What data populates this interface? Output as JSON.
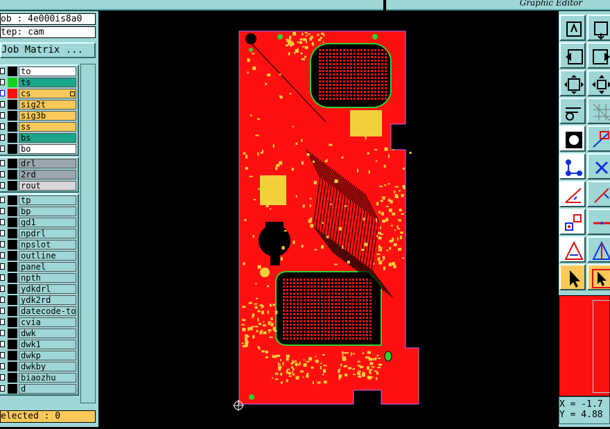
{
  "app": {
    "title": "Graphic Editor"
  },
  "job": {
    "label": "ob : 4e000is8a0",
    "step_label": "tep: cam"
  },
  "job_matrix_button": "Job Matrix ...",
  "board_layers": [
    {
      "name": "to",
      "swatch": "#000000",
      "bg": "#ffffff"
    },
    {
      "name": "ts",
      "swatch": "#18d020",
      "bg": "#1aa68a"
    },
    {
      "name": "cs",
      "swatch": "#ff1010",
      "bg": "#fbc95a"
    },
    {
      "name": "sig2t",
      "swatch": "#000000",
      "bg": "#fbc95a"
    },
    {
      "name": "sig3b",
      "swatch": "#000000",
      "bg": "#fbc95a"
    },
    {
      "name": "ss",
      "swatch": "#000000",
      "bg": "#fbc95a"
    },
    {
      "name": "bs",
      "swatch": "#000000",
      "bg": "#1aa68a"
    },
    {
      "name": "bo",
      "swatch": "#000000",
      "bg": "#ffffff"
    }
  ],
  "drill_layers": [
    {
      "name": "drl",
      "swatch": "#000000",
      "bg": "#9aa6b0"
    },
    {
      "name": "2rd",
      "swatch": "#000000",
      "bg": "#9aa6b0"
    },
    {
      "name": "rout",
      "swatch": "#000000",
      "bg": "#d8d8d8"
    }
  ],
  "misc_layers": [
    {
      "name": "tp",
      "swatch": "#000000",
      "bg": "#9fd6d6"
    },
    {
      "name": "bp",
      "swatch": "#000000",
      "bg": "#9fd6d6"
    },
    {
      "name": "gd1",
      "swatch": "#000000",
      "bg": "#9fd6d6"
    },
    {
      "name": "npdrl",
      "swatch": "#000000",
      "bg": "#9fd6d6"
    },
    {
      "name": "npslot",
      "swatch": "#000000",
      "bg": "#9fd6d6"
    },
    {
      "name": "outline",
      "swatch": "#000000",
      "bg": "#9fd6d6"
    },
    {
      "name": "panel",
      "swatch": "#000000",
      "bg": "#9fd6d6"
    },
    {
      "name": "npth",
      "swatch": "#000000",
      "bg": "#9fd6d6"
    },
    {
      "name": "ydkdrl",
      "swatch": "#000000",
      "bg": "#9fd6d6"
    },
    {
      "name": "ydk2rd",
      "swatch": "#000000",
      "bg": "#9fd6d6"
    },
    {
      "name": "datecode-to",
      "swatch": "#000000",
      "bg": "#9fd6d6"
    },
    {
      "name": "cvia",
      "swatch": "#000000",
      "bg": "#9fd6d6"
    },
    {
      "name": "dwk",
      "swatch": "#000000",
      "bg": "#9fd6d6"
    },
    {
      "name": "dwk1",
      "swatch": "#000000",
      "bg": "#9fd6d6"
    },
    {
      "name": "dwkp",
      "swatch": "#000000",
      "bg": "#9fd6d6"
    },
    {
      "name": "dwkby",
      "swatch": "#000000",
      "bg": "#9fd6d6"
    },
    {
      "name": "biaozhu",
      "swatch": "#000000",
      "bg": "#9fd6d6"
    },
    {
      "name": "d",
      "swatch": "#000000",
      "bg": "#9fd6d6"
    }
  ],
  "selected_label": "elected : 0",
  "coords": {
    "x": "X = -1.7",
    "y": "Y = 4.88"
  },
  "colors": {
    "board": "#ff1010",
    "copper_pad": "#f4d03a",
    "board_edge": "#b070ff",
    "panel_bg": "#9fd6d6",
    "highlight": "#fbc95a",
    "active_green": "#1aa68a"
  },
  "tools": [
    "zoom-home-icon",
    "zoom-box-icon",
    "pan-left-icon",
    "pan-right-icon",
    "fit-all-icon",
    "zoom-center-icon",
    "measure-icon",
    "grid-icon",
    "snap-point-icon",
    "snap-edge-icon",
    "node-link-icon",
    "cross-icon",
    "angle-icon",
    "slope-icon",
    "select-shape-icon",
    "line-icon",
    "triangle-icon",
    "mirror-triangle-icon",
    "pointer-icon",
    "pointer-box-icon"
  ]
}
